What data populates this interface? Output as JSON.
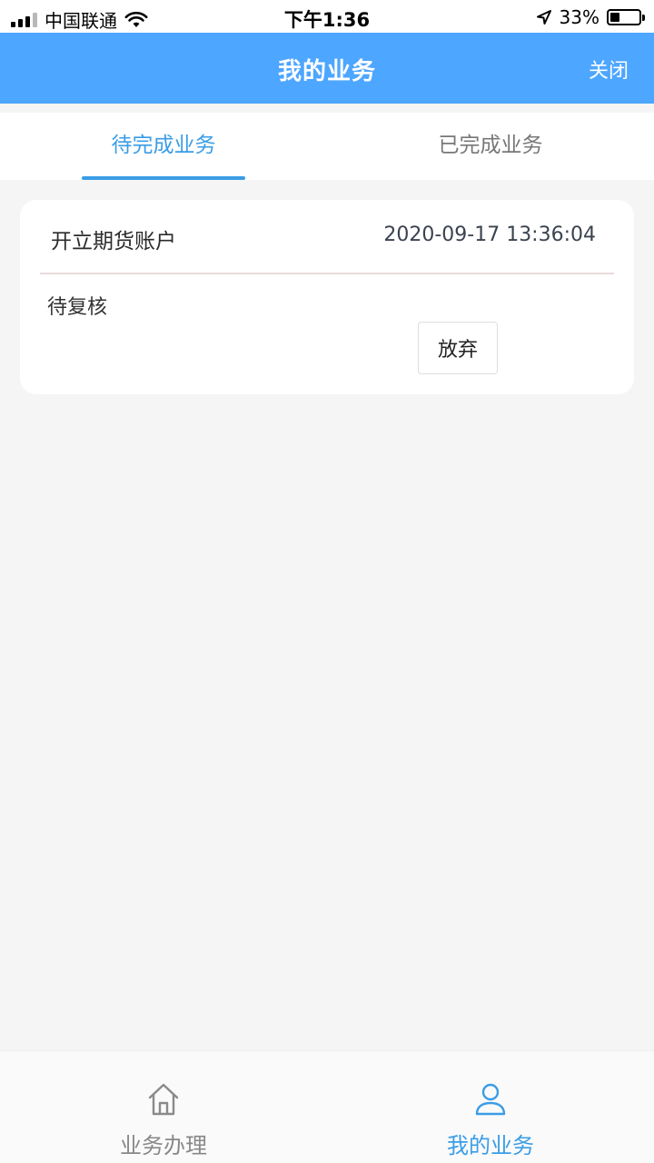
{
  "status_bar": {
    "carrier": "中国联通",
    "time": "下午1:36",
    "battery_percent": "33%",
    "battery_level": 0.33,
    "icons": [
      "signal-icon",
      "wifi-icon",
      "location-arrow-icon",
      "battery-icon"
    ]
  },
  "header": {
    "title": "我的业务",
    "close_label": "关闭",
    "color": "#4da6ff"
  },
  "tabs": [
    {
      "label": "待完成业务",
      "active": true
    },
    {
      "label": "已完成业务",
      "active": false
    }
  ],
  "card": {
    "title": "开立期货账户",
    "time": "2020-09-17 13:36:04",
    "status": "待复核",
    "action_label": "放弃"
  },
  "bottom_nav": {
    "items": [
      {
        "label": "业务办理",
        "icon": "home-icon",
        "active": false
      },
      {
        "label": "我的业务",
        "icon": "user-icon",
        "active": true
      }
    ],
    "active_color": "#3a9de6",
    "inactive_color": "#888888"
  }
}
